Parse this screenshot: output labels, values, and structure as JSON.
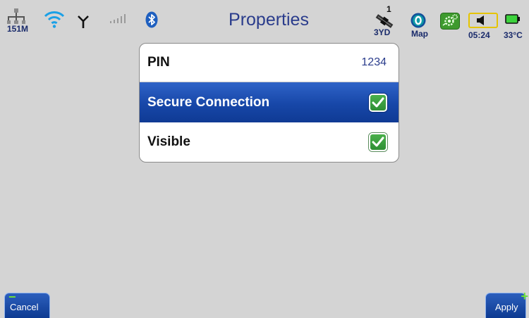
{
  "status_bar": {
    "network_label": "151M",
    "satellite_count": "1",
    "satellite_label": "3YD",
    "map_label": "Map",
    "time": "05:24",
    "temperature": "33°C",
    "icons": [
      "network-icon",
      "wifi-icon",
      "antenna-icon",
      "signal-strength-icon",
      "bluetooth-icon",
      "satellite-icon",
      "map-icon",
      "gear-icon",
      "speaker-icon",
      "battery-icon"
    ]
  },
  "page": {
    "title": "Properties"
  },
  "properties": [
    {
      "label": "PIN",
      "value": "1234"
    },
    {
      "label": "Secure Connection",
      "checked": true,
      "selected": true
    },
    {
      "label": "Visible",
      "checked": true
    }
  ],
  "buttons": {
    "cancel": "Cancel",
    "apply": "Apply"
  },
  "colors": {
    "title": "#2a3c8c",
    "selected_row": "#1747a8",
    "checkbox": "#3ca03f",
    "background": "#d4d4d4"
  }
}
